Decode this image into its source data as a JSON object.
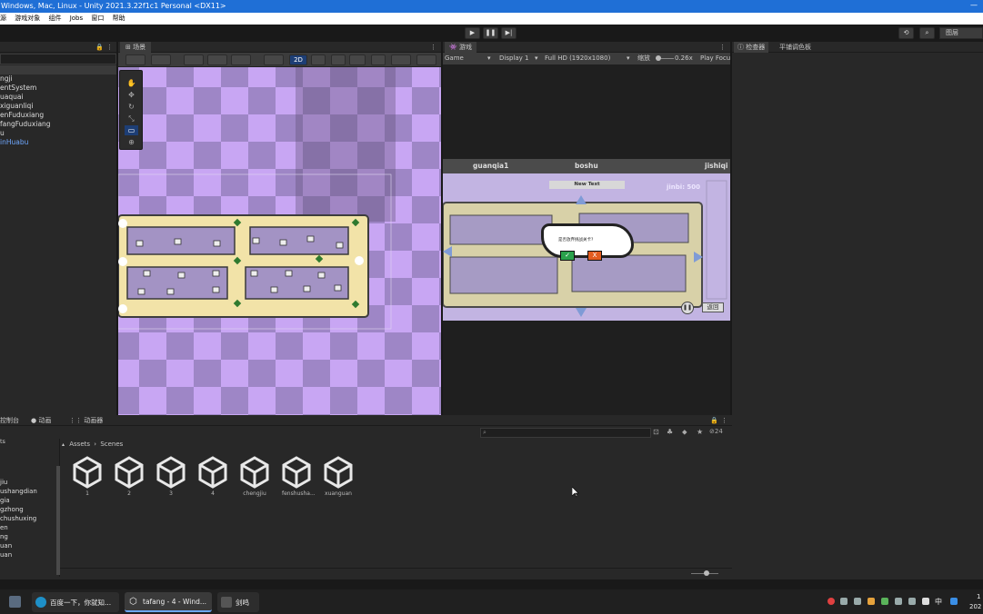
{
  "window": {
    "title": "Windows, Mac, Linux - Unity 2021.3.22f1c1 Personal <DX11>",
    "minimize": "—"
  },
  "menu": [
    "源",
    "游戏对象",
    "组件",
    "Jobs",
    "窗口",
    "帮助"
  ],
  "toolbar": {
    "play": "▶",
    "pause": "❚❚",
    "step": "▶|",
    "layers": "图层"
  },
  "hierarchy": {
    "items": [
      "ngji",
      "entSystem",
      "uaquai",
      "xiguanliqi",
      "enFuduxiang",
      "fangFuduxiang",
      "u",
      "inHuabu"
    ]
  },
  "scene": {
    "tab": "场景",
    "mode_2d": "2D",
    "selection_color": "#1d3e75"
  },
  "game": {
    "tab": "游戏",
    "mode": "Game",
    "display": "Display 1",
    "resolution": "Full HD (1920x1080)",
    "scale_label": "缩放",
    "scale_value": "0.26x",
    "play_focused": "Play Focu",
    "hud": {
      "guanqia": "guanqia1",
      "boshu": "boshu",
      "jishiqi": "jishiqi",
      "new_text": "New Text",
      "jinbi": "jinbi: 500",
      "back": "返回"
    },
    "dialog": {
      "text": "是否放弃挑战关卡?"
    }
  },
  "inspector": {
    "tab1": "检查器",
    "tab2": "平铺调色板"
  },
  "bottom": {
    "tab1": "控制台",
    "tab2": "动画",
    "tab3": "动画器",
    "breadcrumb_root": "Assets",
    "breadcrumb_sep": "›",
    "breadcrumb_current": "Scenes",
    "hidden_count": "24",
    "tree": [
      "ts",
      "jiu",
      "ushangdian",
      "gia",
      "gzhong",
      "chushuxing",
      "en",
      "ng",
      "uan",
      "uan"
    ],
    "assets": [
      "1",
      "2",
      "3",
      "4",
      "chengjiu",
      "fenshusha...",
      "xuanguan"
    ]
  },
  "taskbar": {
    "edge_title": "百度一下，你就知...",
    "unity_title": "tafang - 4 - Wind...",
    "third_title": "剑鸣",
    "ime": "中",
    "clock_1": "1",
    "clock_2": "202"
  }
}
